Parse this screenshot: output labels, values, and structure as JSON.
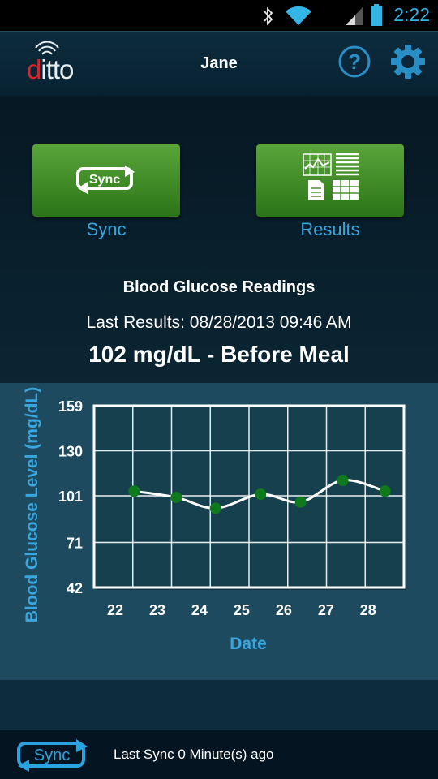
{
  "status_bar": {
    "time": "2:22"
  },
  "header": {
    "logo_text": "ditto",
    "user_name": "Jane"
  },
  "actions": {
    "sync_label": "Sync",
    "results_label": "Results",
    "sync_icon_text": "Sync"
  },
  "summary": {
    "title": "Blood Glucose Readings",
    "last_results": "Last Results: 08/28/2013 09:46 AM",
    "reading": "102 mg/dL - Before Meal"
  },
  "chart_data": {
    "type": "line",
    "ylabel": "Blood Glucose Level (mg/dL)",
    "xlabel": "Date",
    "ylim": [
      42,
      159
    ],
    "yticks": [
      42,
      71,
      101,
      130,
      159
    ],
    "xticks": [
      22,
      23,
      24,
      25,
      26,
      27,
      28
    ],
    "xlim": [
      21.5,
      28.85
    ],
    "grid": true,
    "x": [
      22.45,
      23.45,
      24.38,
      25.45,
      26.4,
      27.4,
      28.4
    ],
    "y": [
      104,
      100,
      93,
      102,
      97,
      111,
      104
    ],
    "colors": {
      "line": "#ffffff",
      "marker": "#0f7a1c",
      "plot_bg": "#17404f",
      "axis_text": "#ffffff",
      "label_text": "#39a6df"
    }
  },
  "footer": {
    "sync_icon_text": "Sync",
    "last_sync": "Last Sync 0 Minute(s) ago"
  }
}
